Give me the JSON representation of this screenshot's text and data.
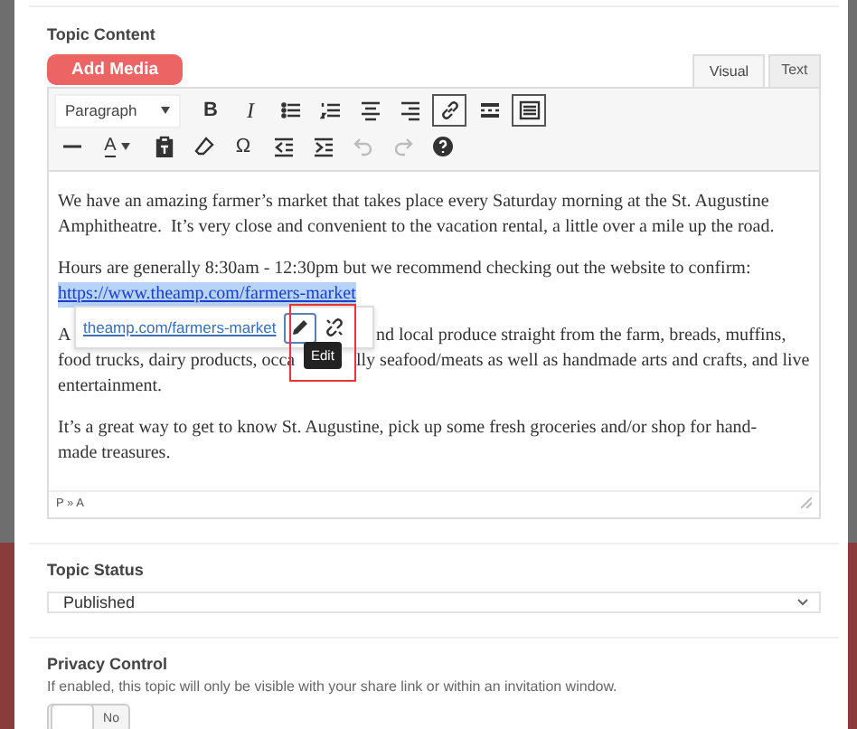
{
  "section_title": "Topic Content",
  "add_media": "Add Media",
  "editor_tabs": [
    {
      "label": "Visual",
      "selected": true
    },
    {
      "label": "Text",
      "selected": false
    }
  ],
  "toolbar_rows": [
    [
      {
        "kind": "format-select",
        "label": "Paragraph"
      },
      {
        "kind": "bold",
        "label": "B",
        "active": false,
        "disabled": false
      },
      {
        "kind": "italic",
        "label": "I",
        "active": false,
        "disabled": false
      },
      {
        "kind": "bullet-list",
        "active": false,
        "disabled": false
      },
      {
        "kind": "numbered-list",
        "active": false,
        "disabled": false
      },
      {
        "kind": "align-center",
        "active": false,
        "disabled": false
      },
      {
        "kind": "align-right",
        "active": false,
        "disabled": false
      },
      {
        "kind": "link",
        "active": true,
        "disabled": false
      },
      {
        "kind": "read-more",
        "active": false,
        "disabled": false
      },
      {
        "kind": "toolbar-toggle",
        "active": true,
        "disabled": false
      }
    ],
    [
      {
        "kind": "horizontal-line",
        "active": false,
        "disabled": false
      },
      {
        "kind": "text-color",
        "label": "A",
        "active": false,
        "disabled": false
      },
      {
        "kind": "paste-text",
        "active": false,
        "disabled": false
      },
      {
        "kind": "clear-format",
        "active": false,
        "disabled": false
      },
      {
        "kind": "special-char",
        "label": "Ω",
        "active": false,
        "disabled": false
      },
      {
        "kind": "outdent",
        "active": false,
        "disabled": false
      },
      {
        "kind": "indent",
        "active": false,
        "disabled": false
      },
      {
        "kind": "undo",
        "active": false,
        "disabled": true
      },
      {
        "kind": "redo",
        "active": false,
        "disabled": true
      },
      {
        "kind": "help",
        "active": false,
        "disabled": false
      }
    ]
  ],
  "paragraphs": [
    {
      "lines": [
        [
          {
            "kind": "text",
            "text": "We have an amazing farmer’s market that takes place every Saturday morning at the St. Augustine"
          }
        ],
        [
          {
            "kind": "text",
            "text": "Amphitheatre.  It’s very close and convenient to the vacation rental, a little over a mile up the road."
          }
        ]
      ]
    },
    {
      "lines": [
        [
          {
            "kind": "text",
            "text": "Hours are generally 8:30am - 12:30pm but we recommend checking out the website to confirm:"
          }
        ],
        [
          {
            "kind": "link",
            "text": "https://www.theamp.com/farmers-market"
          }
        ]
      ]
    },
    {
      "lines": [
        [
          {
            "kind": "text",
            "text": "A"
          },
          {
            "kind": "text",
            "text": "nd local produce straight from the farm, breads, muffins,"
          }
        ],
        [
          {
            "kind": "text",
            "text": "food trucks, dairy products, occa"
          },
          {
            "kind": "text",
            "text": "lly seafood/meats as well as handmade arts and crafts, and live"
          }
        ],
        [
          {
            "kind": "text",
            "text": "entertainment."
          }
        ]
      ]
    },
    {
      "lines": [
        [
          {
            "kind": "text",
            "text": "It’s a great way to get to know St. Augustine, pick up some fresh groceries and/or shop for hand-"
          }
        ],
        [
          {
            "kind": "text",
            "text": "made treasures."
          }
        ]
      ]
    }
  ],
  "link_popup": {
    "url": "theamp.com/farmers-market",
    "tooltip": "Edit"
  },
  "status_path": "P » A",
  "topic_status": {
    "label": "Topic Status",
    "value": "Published"
  },
  "privacy": {
    "label": "Privacy Control",
    "description": "If enabled, this topic will only be visible with your share link or within an invitation window.",
    "toggle": {
      "label": "No",
      "on": false
    }
  }
}
